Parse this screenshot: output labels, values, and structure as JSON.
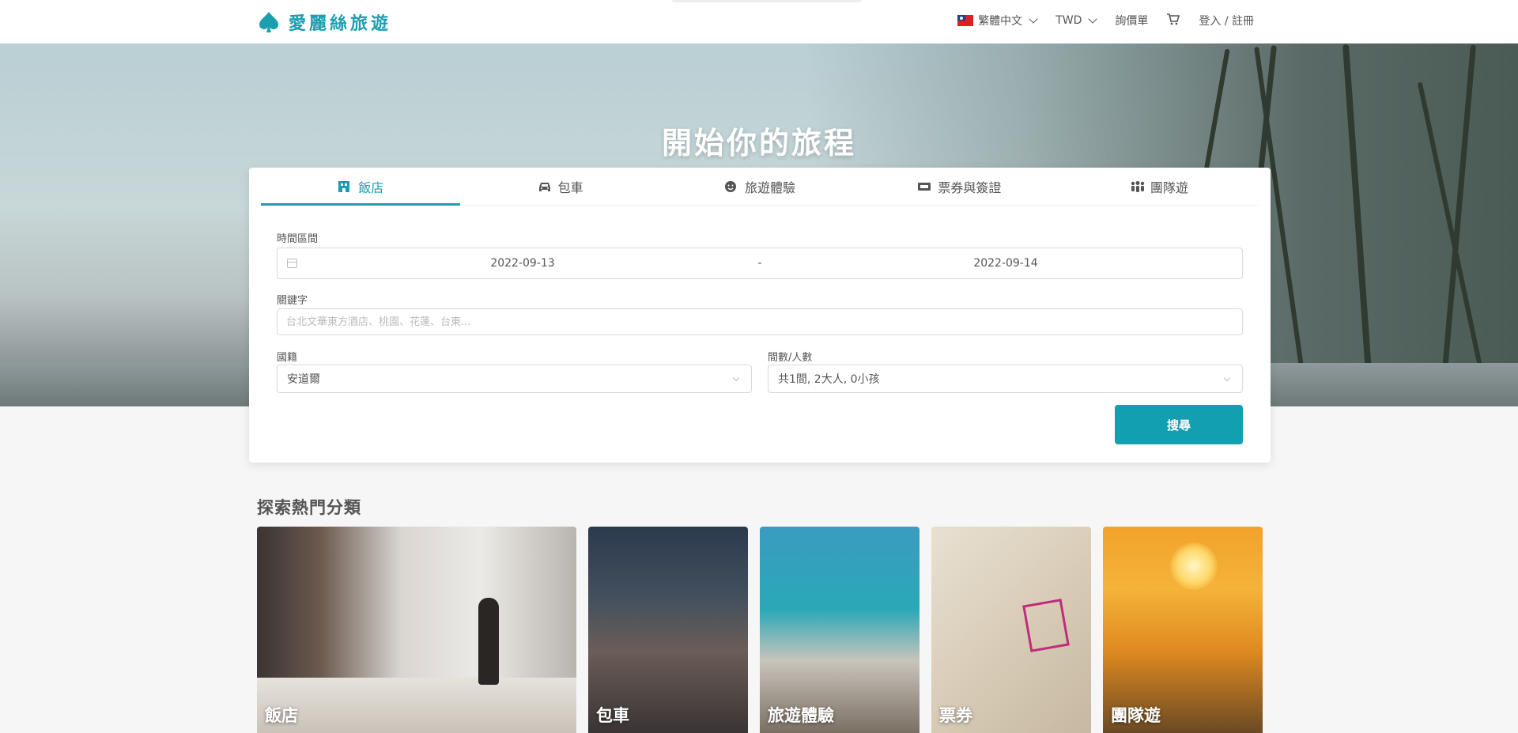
{
  "header": {
    "logo_text": "愛麗絲旅遊",
    "language": "繁體中文",
    "currency": "TWD",
    "cart_label": "詢價單",
    "login_label": "登入 / 註冊",
    "colors": {
      "brand": "#1b9fb0"
    }
  },
  "hero": {
    "title": "開始你的旅程"
  },
  "search": {
    "tabs": [
      {
        "label": "飯店",
        "icon": "hotel-icon",
        "active": true
      },
      {
        "label": "包車",
        "icon": "car-icon",
        "active": false
      },
      {
        "label": "旅遊體驗",
        "icon": "smile-icon",
        "active": false
      },
      {
        "label": "票券與簽證",
        "icon": "ticket-icon",
        "active": false
      },
      {
        "label": "團隊遊",
        "icon": "group-icon",
        "active": false
      }
    ],
    "date_label": "時間區間",
    "date_start": "2022-09-13",
    "date_separator": "-",
    "date_end": "2022-09-14",
    "keyword_label": "關鍵字",
    "keyword_placeholder": "台北文華東方酒店、桃園、花蓮、台東...",
    "nationality_label": "國籍",
    "nationality_value": "安道爾",
    "rooms_label": "間數/人數",
    "rooms_value": "共1間, 2大人, 0小孩",
    "search_button": "搜尋"
  },
  "categories": {
    "title": "探索熱門分類",
    "items": [
      {
        "label": "飯店"
      },
      {
        "label": "包車"
      },
      {
        "label": "旅遊體驗"
      },
      {
        "label": "票券"
      },
      {
        "label": "團隊遊"
      }
    ]
  }
}
